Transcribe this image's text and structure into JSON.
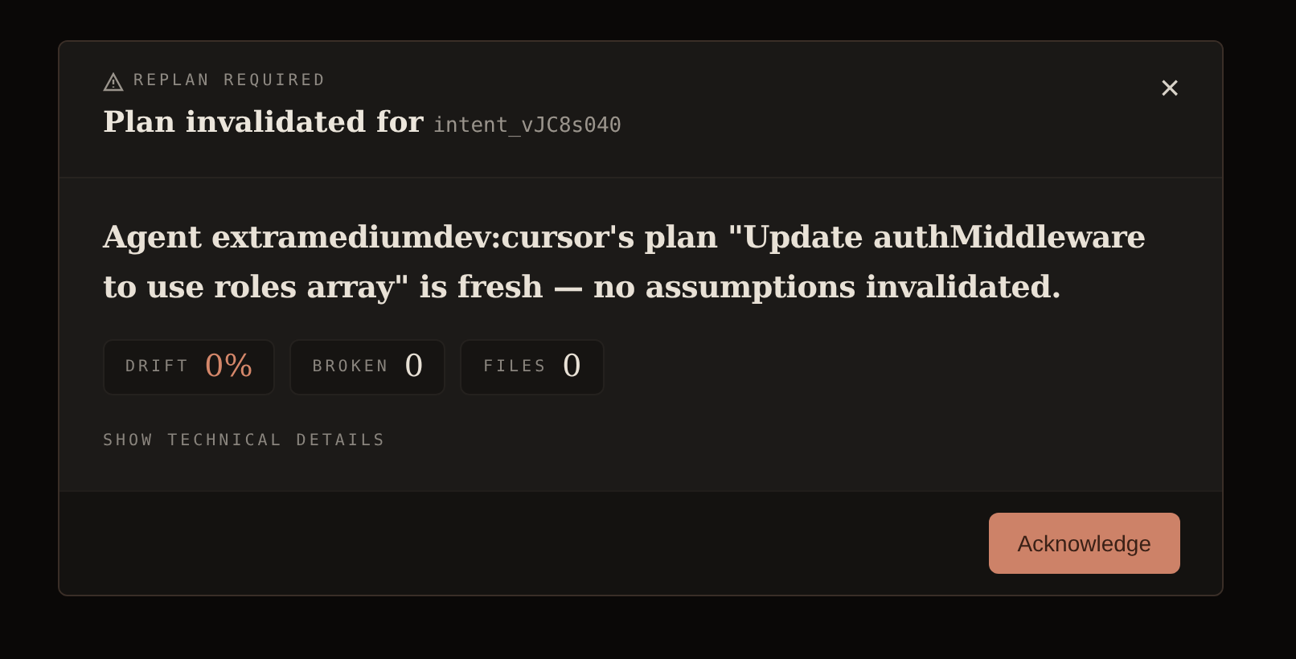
{
  "dialog": {
    "eyebrow": "REPLAN REQUIRED",
    "title": "Plan invalidated for",
    "intent_id": "intent_vJC8s040",
    "close": "×",
    "message": "Agent extramediumdev:cursor's plan \"Update authMiddleware to use roles array\" is fresh — no assumptions invalidated.",
    "stats": [
      {
        "label": "DRIFT",
        "value": "0%",
        "accent": true
      },
      {
        "label": "BROKEN",
        "value": "0",
        "accent": false
      },
      {
        "label": "FILES",
        "value": "0",
        "accent": false
      }
    ],
    "details_link": "SHOW TECHNICAL DETAILS",
    "buttons": [
      "Acknowledge"
    ]
  }
}
